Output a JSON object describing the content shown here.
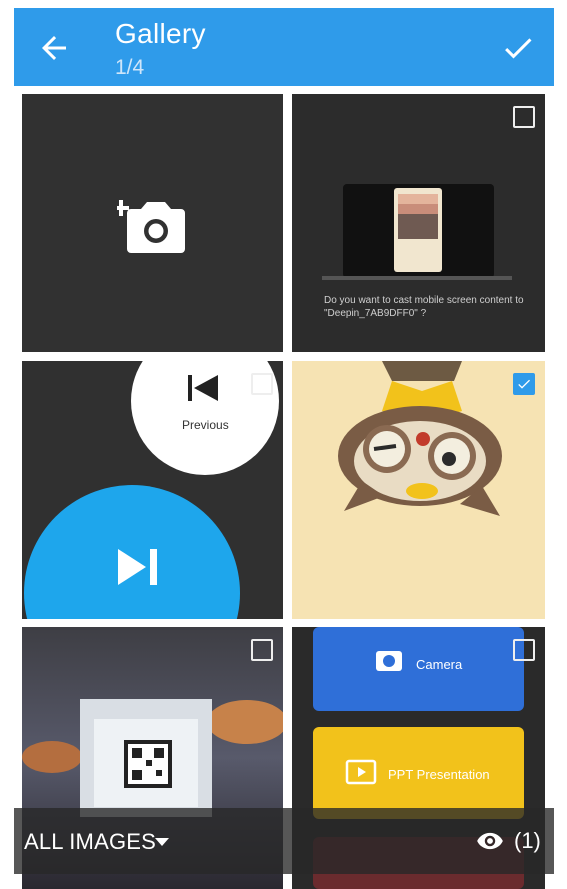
{
  "header": {
    "title": "Gallery",
    "subtitle": "1/4",
    "back_icon": "arrow-left-icon",
    "confirm_icon": "check-icon"
  },
  "tiles": [
    {
      "kind": "camera",
      "icon": "add-photo-icon",
      "selectable": false
    },
    {
      "kind": "image",
      "caption": "Do you want to cast mobile screen content to \"Deepin_7AB9DFF0\" ?",
      "checked": false
    },
    {
      "kind": "image",
      "label": "Previous",
      "checked": false
    },
    {
      "kind": "image",
      "checked": true
    },
    {
      "kind": "image",
      "checked": false
    },
    {
      "kind": "image",
      "labels": [
        "Camera",
        "PPT Presentation"
      ],
      "checked": false
    }
  ],
  "footer": {
    "album": "ALL IMAGES",
    "selected_count": "(1)",
    "eye_icon": "eye-icon"
  },
  "colors": {
    "accent": "#2f9bea",
    "bar": "#282828"
  }
}
